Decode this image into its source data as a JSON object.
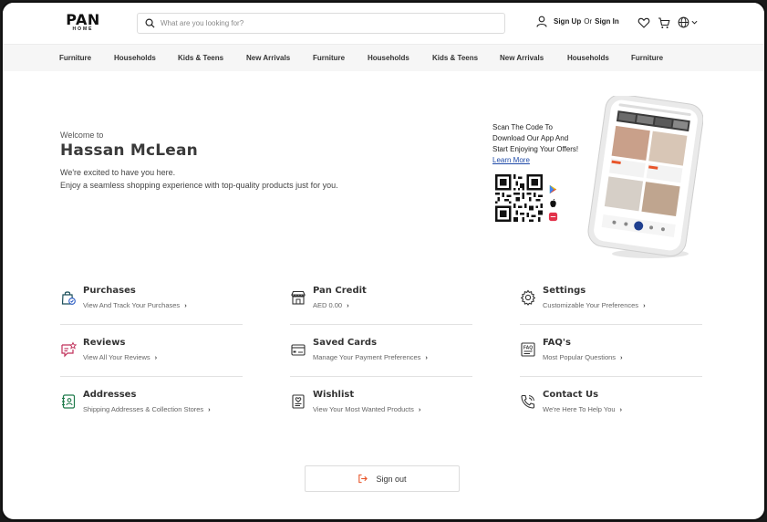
{
  "brand": {
    "name": "PAN",
    "sub": "HOME"
  },
  "search": {
    "placeholder": "What are you looking for?"
  },
  "auth": {
    "sign_up": "Sign Up",
    "or": "Or",
    "sign_in": "Sign In"
  },
  "nav": {
    "items": [
      "Furniture",
      "Households",
      "Kids & Teens",
      "New Arrivals",
      "Furniture",
      "Households",
      "Kids & Teens",
      "New Arrivals",
      "Households",
      "Furniture"
    ]
  },
  "welcome": {
    "pre": "Welcome to",
    "name": "Hassan McLean",
    "line1": "We're excited to have you here.",
    "line2": "Enjoy a seamless shopping experience with top-quality products just for you."
  },
  "promo": {
    "text": "Scan The Code To Download Our App And Start Enjoying Your Offers!",
    "link": "Learn More"
  },
  "menu": {
    "purchases": {
      "title": "Purchases",
      "sub": "View And Track Your Purchases"
    },
    "pan_credit": {
      "title": "Pan Credit",
      "sub": "AED 0.00"
    },
    "settings": {
      "title": "Settings",
      "sub": "Customizable Your Preferences"
    },
    "reviews": {
      "title": "Reviews",
      "sub": "View All Your Reviews"
    },
    "saved_cards": {
      "title": "Saved Cards",
      "sub": "Manage Your Payment Preferences"
    },
    "faqs": {
      "title": "FAQ's",
      "sub": "Most Popular Questions"
    },
    "addresses": {
      "title": "Addresses",
      "sub": "Shipping Addresses & Collection Stores"
    },
    "wishlist": {
      "title": "Wishlist",
      "sub": "View Your Most Wanted Products"
    },
    "contact": {
      "title": "Contact Us",
      "sub": "We're Here To Help You"
    }
  },
  "signout": {
    "label": "Sign out"
  },
  "colors": {
    "accent": "#e8552a",
    "nav_bg": "#f6f6f6",
    "link": "#1f4aa8",
    "icon_line": "#1c4f5a"
  }
}
